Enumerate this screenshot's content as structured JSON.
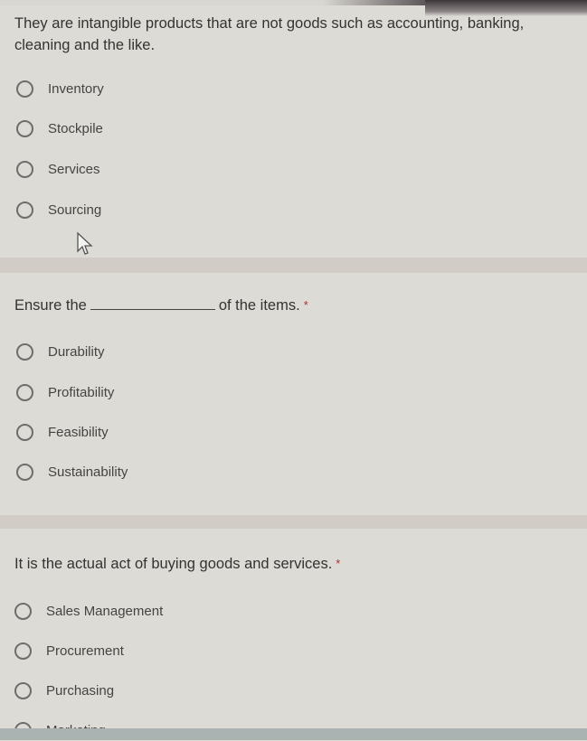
{
  "questions": [
    {
      "text": "They are intangible products that are not goods such as accounting, banking, cleaning and the like.",
      "options": [
        "Inventory",
        "Stockpile",
        "Services",
        "Sourcing"
      ]
    },
    {
      "text_before": "Ensure the",
      "text_after": "of the items.",
      "required": "*",
      "options": [
        "Durability",
        "Profitability",
        "Feasibility",
        "Sustainability"
      ]
    },
    {
      "text": "It is the actual act of buying goods and services.",
      "required": "*",
      "options": [
        "Sales Management",
        "Procurement",
        "Purchasing",
        "Marketing"
      ]
    }
  ]
}
